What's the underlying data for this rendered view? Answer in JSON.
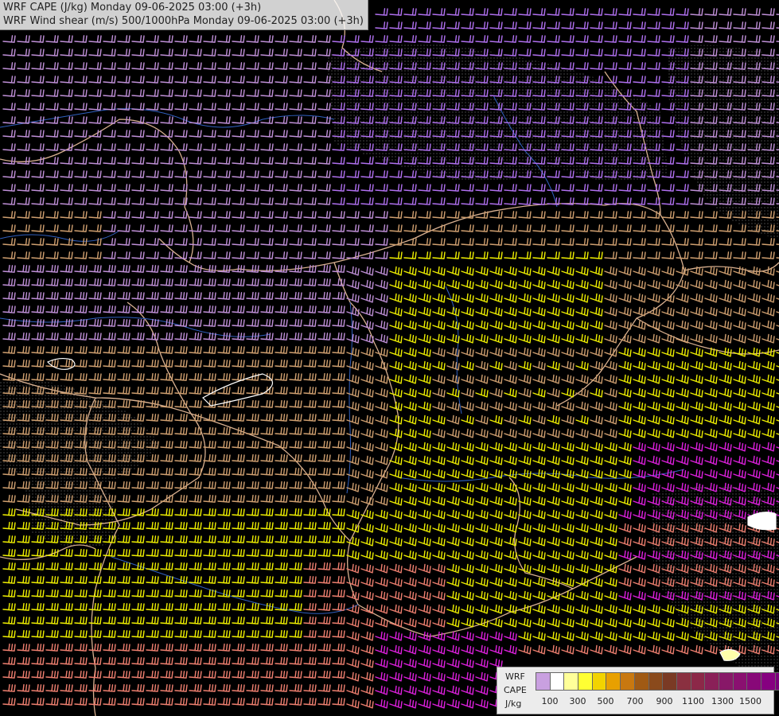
{
  "titles": {
    "line1": "WRF CAPE (J/kg) Monday 09-06-2025 03:00 (+3h)",
    "line2": "WRF Wind shear (m/s) 500/1000hPa Monday 09-06-2025 03:00 (+3h)"
  },
  "legend": {
    "label_model": "WRF",
    "label_var": "CAPE",
    "label_unit": "J/kg",
    "ticks": [
      "100",
      "300",
      "500",
      "700",
      "900",
      "1100",
      "1300",
      "1500"
    ],
    "colors": [
      "#c9a0e0",
      "#ffffff",
      "#ffff99",
      "#ffff33",
      "#f2d300",
      "#e8a000",
      "#c87810",
      "#a05a14",
      "#8a4a1c",
      "#7a3a24",
      "#8a3040",
      "#8c2848",
      "#8a2058",
      "#881868",
      "#8a1070",
      "#880878",
      "#860080",
      "#7a007a"
    ]
  },
  "map_colors": {
    "violet": "#b070f0",
    "lavender": "#c090d8",
    "tan": "#d0a070",
    "yellow": "#f0f000",
    "salmon": "#f08070",
    "magenta": "#e020e0",
    "border": "#d8b090",
    "river": "#3060c0"
  }
}
